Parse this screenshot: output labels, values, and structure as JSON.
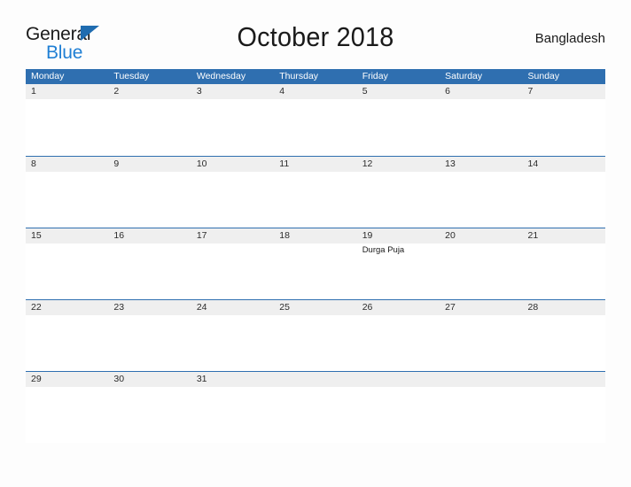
{
  "logo": {
    "word_top": "General",
    "word_bottom": "Blue",
    "mark": "flag-triangle-icon",
    "color_top": "#1b1b1b",
    "color_bottom": "#1f7fd4",
    "color_mark": "#1f6cb0"
  },
  "header": {
    "title": "October 2018",
    "region": "Bangladesh"
  },
  "theme": {
    "header_blue": "#2f6fb0",
    "band_gray": "#efefef",
    "page_background": "#fdfdfd",
    "text_dark": "#2b2b2b"
  },
  "calendar": {
    "day_names": [
      "Monday",
      "Tuesday",
      "Wednesday",
      "Thursday",
      "Friday",
      "Saturday",
      "Sunday"
    ],
    "weeks": [
      [
        {
          "date": "1",
          "event": ""
        },
        {
          "date": "2",
          "event": ""
        },
        {
          "date": "3",
          "event": ""
        },
        {
          "date": "4",
          "event": ""
        },
        {
          "date": "5",
          "event": ""
        },
        {
          "date": "6",
          "event": ""
        },
        {
          "date": "7",
          "event": ""
        }
      ],
      [
        {
          "date": "8",
          "event": ""
        },
        {
          "date": "9",
          "event": ""
        },
        {
          "date": "10",
          "event": ""
        },
        {
          "date": "11",
          "event": ""
        },
        {
          "date": "12",
          "event": ""
        },
        {
          "date": "13",
          "event": ""
        },
        {
          "date": "14",
          "event": ""
        }
      ],
      [
        {
          "date": "15",
          "event": ""
        },
        {
          "date": "16",
          "event": ""
        },
        {
          "date": "17",
          "event": ""
        },
        {
          "date": "18",
          "event": ""
        },
        {
          "date": "19",
          "event": "Durga Puja"
        },
        {
          "date": "20",
          "event": ""
        },
        {
          "date": "21",
          "event": ""
        }
      ],
      [
        {
          "date": "22",
          "event": ""
        },
        {
          "date": "23",
          "event": ""
        },
        {
          "date": "24",
          "event": ""
        },
        {
          "date": "25",
          "event": ""
        },
        {
          "date": "26",
          "event": ""
        },
        {
          "date": "27",
          "event": ""
        },
        {
          "date": "28",
          "event": ""
        }
      ],
      [
        {
          "date": "29",
          "event": ""
        },
        {
          "date": "30",
          "event": ""
        },
        {
          "date": "31",
          "event": ""
        },
        {
          "date": "",
          "event": ""
        },
        {
          "date": "",
          "event": ""
        },
        {
          "date": "",
          "event": ""
        },
        {
          "date": "",
          "event": ""
        }
      ]
    ]
  }
}
